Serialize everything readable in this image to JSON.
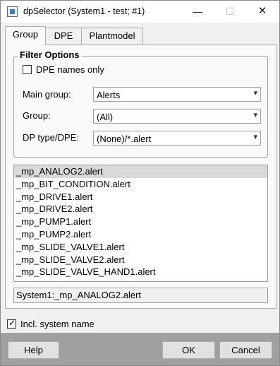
{
  "window": {
    "title": "dpSelector (System1 - test; #1)",
    "minimize_glyph": "—",
    "maximize_glyph": "☐",
    "close_glyph": "✕"
  },
  "tabs": [
    {
      "label": "Group",
      "active": true
    },
    {
      "label": "DPE",
      "active": false
    },
    {
      "label": "Plantmodel",
      "active": false
    }
  ],
  "filter": {
    "title": "Filter Options",
    "dpe_names_only": {
      "label": "DPE names only",
      "checked": false
    },
    "main_group": {
      "label": "Main group:",
      "value": "Alerts"
    },
    "group": {
      "label": "Group:",
      "value": "(All)"
    },
    "dp_type": {
      "label": "DP type/DPE:",
      "value": "(None)/*.alert"
    }
  },
  "list": {
    "items": [
      "_mp_ANALOG2.alert",
      "_mp_BIT_CONDITION.alert",
      "_mp_DRIVE1.alert",
      "_mp_DRIVE2.alert",
      "_mp_PUMP1.alert",
      "_mp_PUMP2.alert",
      "_mp_SLIDE_VALVE1.alert",
      "_mp_SLIDE_VALVE2.alert",
      "_mp_SLIDE_VALVE_HAND1.alert"
    ],
    "selected_index": 0
  },
  "selection_display": "System1:_mp_ANALOG2.alert",
  "incl_system_name": {
    "label": "Incl. system name",
    "checked": true
  },
  "buttons": {
    "help": "Help",
    "ok": "OK",
    "cancel": "Cancel"
  },
  "icons": {
    "dropdown": "▾",
    "check": "✓"
  },
  "colors": {
    "titlebar_bg": "#ffffff",
    "dialog_bg": "#f0f0f0",
    "bottom_bar_bg": "#a0a0a0",
    "selected_row_bg": "#d9d9d9"
  }
}
